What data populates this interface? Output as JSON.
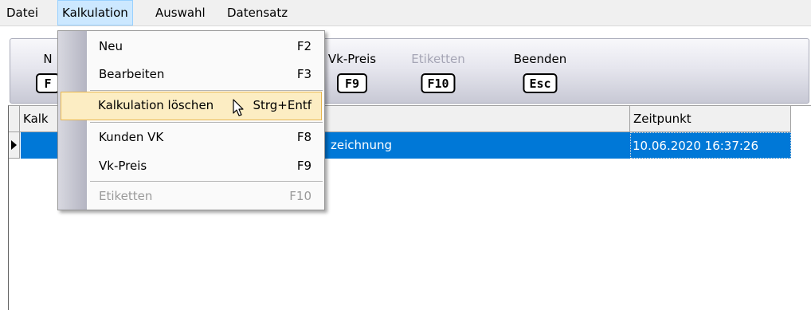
{
  "menubar": {
    "items": [
      {
        "label": "Datei"
      },
      {
        "label": "Kalkulation"
      },
      {
        "label": "Auswahl"
      },
      {
        "label": "Datensatz"
      }
    ]
  },
  "toolbar": {
    "buttons": [
      {
        "label": "N",
        "key": "F"
      },
      {
        "label": "Vk-Preis",
        "key": "F9"
      },
      {
        "label": "Etiketten",
        "key": "F10"
      },
      {
        "label": "Beenden",
        "key": "Esc"
      }
    ],
    "disabled_color": "#a5a5b5"
  },
  "grid": {
    "columns": [
      "Kalk",
      "Zeitpunkt"
    ],
    "rows": [
      {
        "description": "zeichnung",
        "timestamp": "10.06.2020 16:37:26"
      }
    ],
    "selection_color": "#0078d7"
  },
  "kalkulation_menu": {
    "items": [
      {
        "label": "Neu",
        "shortcut": "F2"
      },
      {
        "label": "Bearbeiten",
        "shortcut": "F3"
      },
      {
        "label": "Kalkulation löschen",
        "shortcut": "Strg+Entf",
        "highlighted": true
      },
      {
        "label": "Kunden VK",
        "shortcut": "F8"
      },
      {
        "label": "Vk-Preis",
        "shortcut": "F9"
      },
      {
        "label": "Etiketten",
        "shortcut": "F10",
        "disabled": true
      }
    ],
    "highlight_color": "#fcedc3"
  },
  "cursor": {
    "icon": "arrow-cursor-icon"
  }
}
